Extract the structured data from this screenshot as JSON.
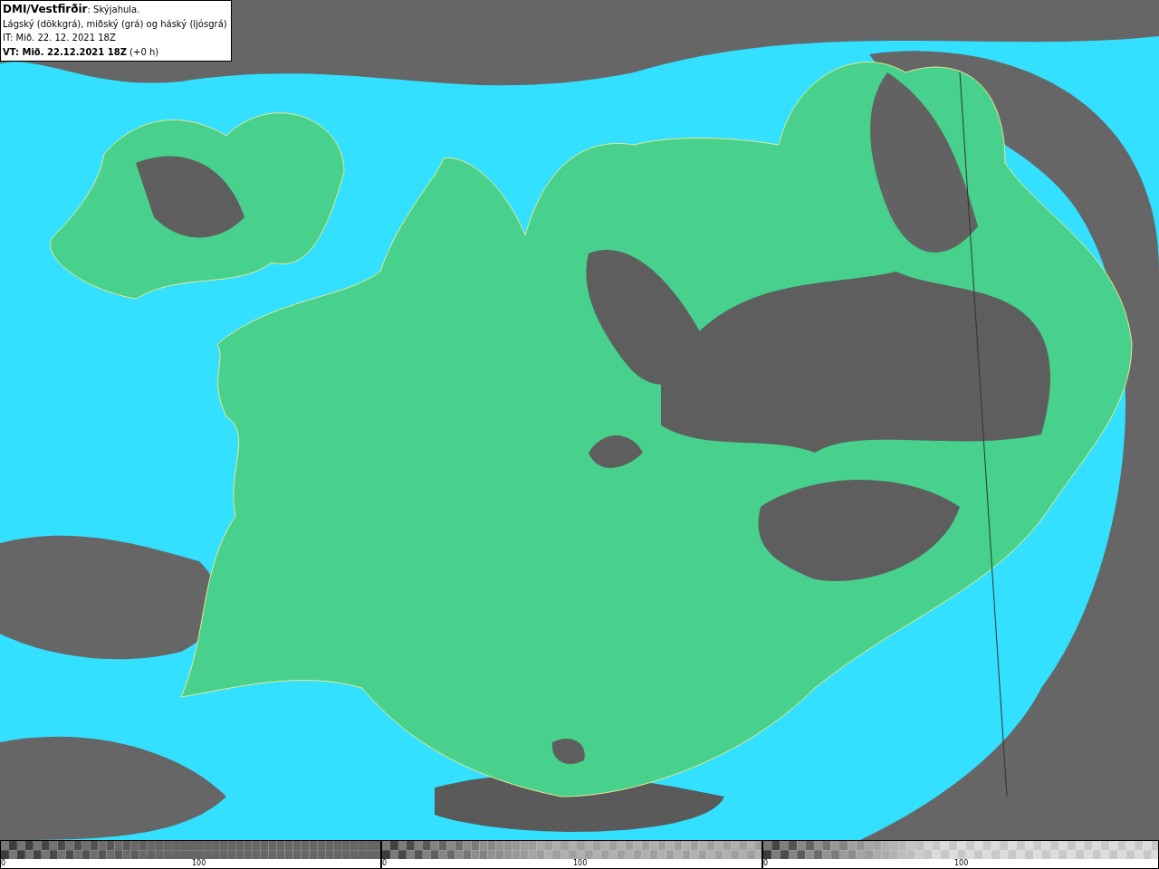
{
  "legend": {
    "lines": [
      "**DMI/Vestfirðir**: Skýjahula.",
      "Lágský (dökkgrá), miðský (grá) og háský (ljósgrá)",
      "IT: Mið. 22. 12. 2021 18Z",
      "**VT: Mið. 22.12.2021 18Z** (+0 h)"
    ]
  },
  "color_bars": [
    {
      "kind": "low",
      "min_label": "0",
      "mid_label": "100"
    },
    {
      "kind": "mid",
      "min_label": "0",
      "mid_label": "100"
    },
    {
      "kind": "high",
      "min_label": "0",
      "mid_label": "100"
    }
  ]
}
